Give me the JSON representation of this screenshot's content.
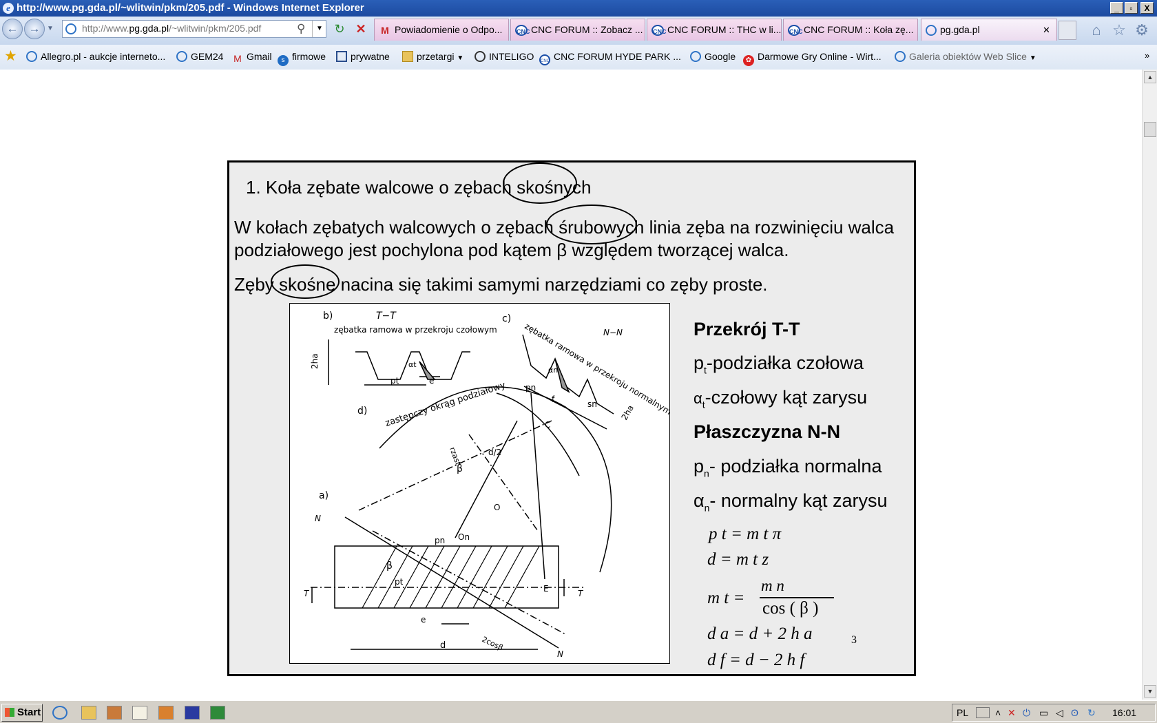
{
  "window": {
    "title": "http://www.pg.gda.pl/~wlitwin/pkm/205.pdf - Windows Internet Explorer",
    "minimize": "_",
    "restore": "▫",
    "close": "X"
  },
  "address_bar": {
    "url_prefix": "http://www.",
    "url_domain": "pg.gda.pl",
    "url_suffix": "/~wlitwin/pkm/205.pdf"
  },
  "tabs": [
    {
      "label": "Powiadomienie o Odpo...",
      "icon": "gmail-icon"
    },
    {
      "label": "CNC FORUM :: Zobacz ...",
      "icon": "cnc-icon"
    },
    {
      "label": "CNC FORUM :: THC w li...",
      "icon": "cnc-icon"
    },
    {
      "label": "CNC FORUM :: Koła zę...",
      "icon": "cnc-icon"
    },
    {
      "label": "pg.gda.pl",
      "icon": "ie-icon",
      "close": "✕"
    }
  ],
  "favorites": [
    {
      "label": "Allegro.pl - aukcje interneto...",
      "icon": "ie-page-icon"
    },
    {
      "label": "GEM24",
      "icon": "ie-page-icon"
    },
    {
      "label": "Gmail",
      "icon": "gmail-icon"
    },
    {
      "label": "firmowe",
      "icon": "messenger-icon"
    },
    {
      "label": "prywatne",
      "icon": "window-icon"
    },
    {
      "label": "przetargi",
      "icon": "folder-icon"
    },
    {
      "label": "INTELIGO",
      "icon": "inteligo-icon"
    },
    {
      "label": "CNC FORUM  HYDE PARK ...",
      "icon": "cnc-icon"
    },
    {
      "label": "Google",
      "icon": "google-icon"
    },
    {
      "label": "Darmowe Gry Online - Wirt...",
      "icon": "games-icon"
    },
    {
      "label": "Galeria obiektów Web Slice",
      "icon": "webslice-icon"
    }
  ],
  "slide": {
    "heading": "1. Koła zębate walcowe o zębach skośnych",
    "para1_line1": "W kołach zębatych walcowych o zębach śrubowych linia zęba na rozwinięciu walca",
    "para1_line2": "podziałowego jest pochylona pod kątem β względem tworzącej walca.",
    "para2": "Zęby skośne nacina się takimi samymi narzędziami co zęby proste.",
    "right_h1": "Przekrój T-T",
    "pt_sym": "p",
    "pt_sub": "t",
    "pt_text": "-podziałka czołowa",
    "at_sym": "α",
    "at_sub": "t",
    "at_text": "-czołowy kąt zarysu",
    "right_h2": "Płaszczyzna N-N",
    "pn_sym": "p",
    "pn_sub": "n",
    "pn_text": "- podziałka normalna",
    "an_sym": "α",
    "an_sub": "n",
    "an_text": "- normalny kąt zarysu",
    "f1": "p  t  =  m  t π",
    "f2": "d  =  m  t z",
    "f3_lhs": "m  t  =",
    "f3_num": "m  n",
    "f3_den": "cos  ( β  )",
    "f4": "d  a  =  d  +  2 h  a",
    "f4_note": "3",
    "f5": "d  f  =  d  −  2 h  f"
  },
  "diagram": {
    "label_a": "a)",
    "label_b": "b)",
    "label_c": "c)",
    "label_d": "d)",
    "tt": "T−T",
    "nn": "N−N",
    "cap_b": "zębatka ramowa w przekroju czołowym",
    "cap_c": "zębatka ramowa w przekroju normalnym",
    "cap_d": "zastępczy okrąg podziałowy",
    "two_ha": "2ha",
    "pt": "pt",
    "e": "e",
    "pn": "pn",
    "sn": "sn",
    "f": "f",
    "alpha_t": "αt",
    "alpha_n": "αn",
    "beta": "β",
    "rzast": "rzast",
    "d2": "d/2",
    "on": "On",
    "o": "O",
    "c": "C",
    "e_pt": "E",
    "n": "N",
    "t": "T",
    "d": "d",
    "d_frac": "d",
    "two_cos": "2cosβ"
  },
  "taskbar": {
    "start": "Start",
    "lang": "PL",
    "clock": "16:01"
  }
}
